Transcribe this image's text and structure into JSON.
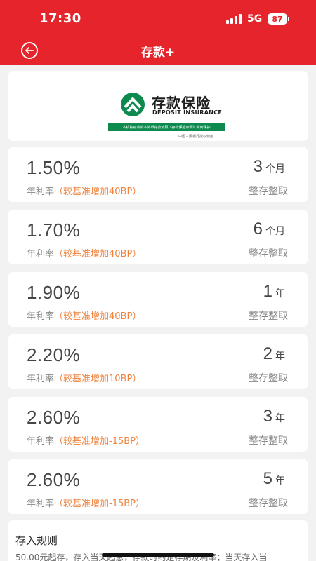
{
  "status_bar": {
    "time": "17:30",
    "network": "5G",
    "battery": "87"
  },
  "nav": {
    "title": "存款+"
  },
  "banner": {
    "logo_cn": "存款保险",
    "logo_en": "DEPOSIT INSURANCE",
    "strip_text": "本机构吸收的本外币存款依照《存款保险条例》受到保护",
    "issuer": "中国人民银行授权使用"
  },
  "rate_label": "年利率",
  "deposit_type": "整存整取",
  "products": [
    {
      "rate": "1.50%",
      "note": "（较基准增加40BP）",
      "term_num": "3",
      "term_unit": "个月"
    },
    {
      "rate": "1.70%",
      "note": "（较基准增加40BP）",
      "term_num": "6",
      "term_unit": "个月"
    },
    {
      "rate": "1.90%",
      "note": "（较基准增加40BP）",
      "term_num": "1",
      "term_unit": "年"
    },
    {
      "rate": "2.20%",
      "note": "（较基准增加10BP）",
      "term_num": "2",
      "term_unit": "年"
    },
    {
      "rate": "2.60%",
      "note": "（较基准增加-15BP）",
      "term_num": "3",
      "term_unit": "年"
    },
    {
      "rate": "2.60%",
      "note": "（较基准增加-15BP）",
      "term_num": "5",
      "term_unit": "年"
    }
  ],
  "rules": {
    "title": "存入规则",
    "text": "50.00元起存，存入当天起息，存款时约定存期及利率；当天存入当"
  },
  "colors": {
    "brand_red": "#e5242b",
    "note_orange": "#f0823c",
    "insurance_green": "#0d8b4f"
  }
}
